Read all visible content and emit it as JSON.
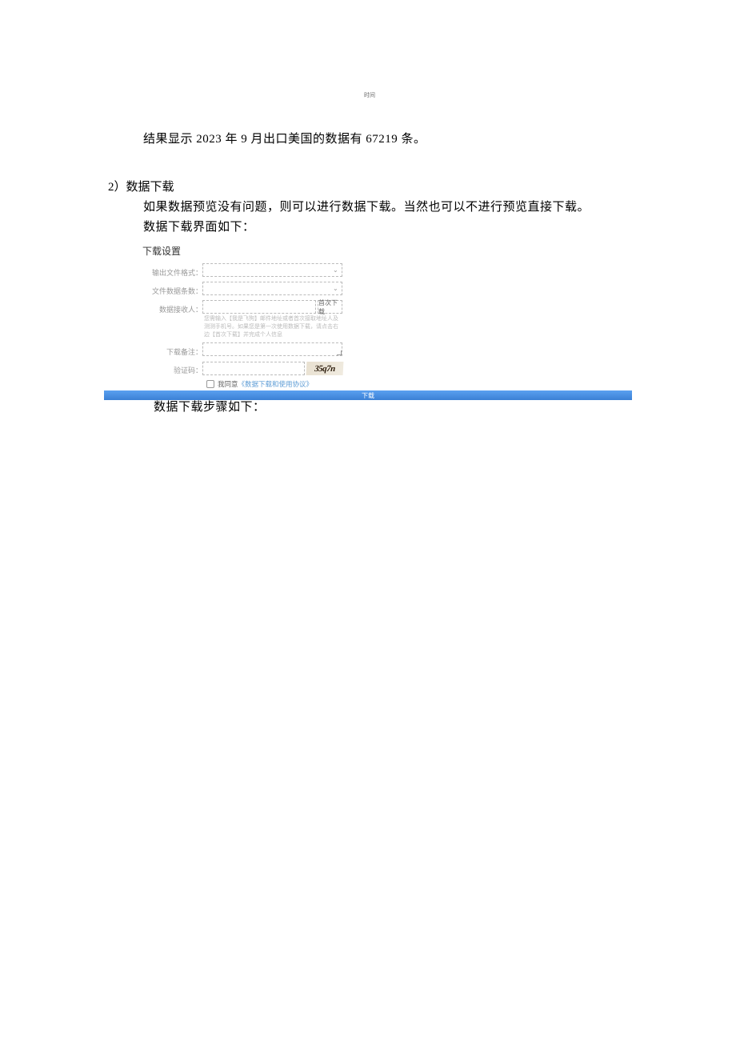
{
  "top_marker": "时间",
  "result_sentence": "结果显示 2023 年 9 月出口美国的数据有 67219 条。",
  "section_heading": "2）数据下载",
  "intro_line_1": "如果数据预览没有问题，则可以进行数据下载。当然也可以不进行预览直接下载。",
  "intro_line_2": "数据下载界面如下：",
  "form": {
    "title": "下载设置",
    "rows": {
      "output_format_label": "输出文件格式：",
      "file_rows_label": "文件数据条数：",
      "receiver_label": "数据接收人：",
      "receiver_button": "首次下载",
      "receiver_hint": "您需输入【我是飞狗】邮件地址或者首次接取地址人及测测手机号。如果您是第一次使用数据下载，请点击右边【首次下载】并完成个人信息",
      "remark_label": "下载备注：",
      "captcha_label": "验证码：",
      "captcha_value": "35q7n"
    },
    "agree_prefix": "我同意",
    "agree_link": "《数据下载和使用协议》",
    "download_button": "下载"
  },
  "steps_sentence": "数据下载步骤如下："
}
